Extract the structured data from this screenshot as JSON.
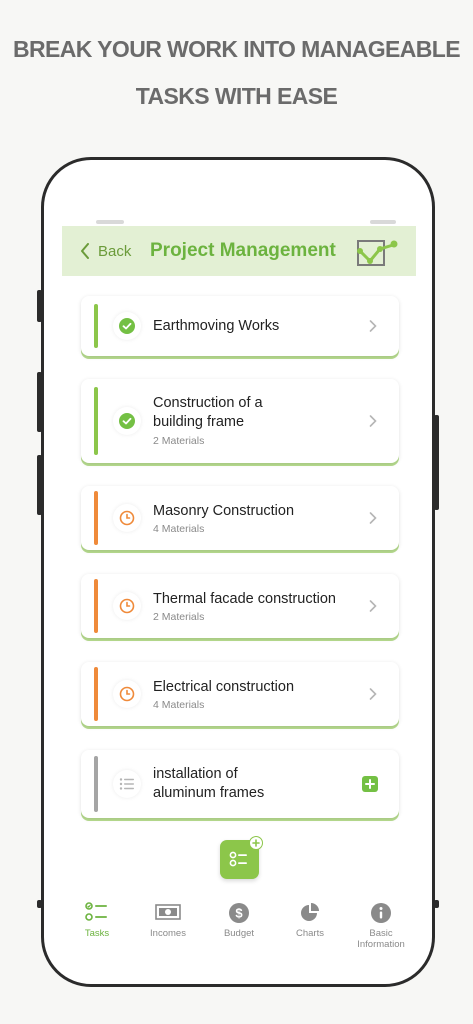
{
  "headline": {
    "line1": "BREAK YOUR WORK INTO MANAGEABLE",
    "line2": "TASKS WITH EASE"
  },
  "header": {
    "back_label": "Back",
    "title": "Project Management",
    "chart_icon": "trend-chart-icon"
  },
  "tasks": [
    {
      "name": "Earthmoving Works",
      "materials": "",
      "status": "done"
    },
    {
      "name": "Construction of a building frame",
      "name_line1": "Construction of a",
      "name_line2": "building frame",
      "materials": "2 Materials",
      "status": "done"
    },
    {
      "name": "Masonry Construction",
      "materials": "4 Materials",
      "status": "in-progress"
    },
    {
      "name": "Thermal facade construction",
      "materials": "2 Materials",
      "status": "in-progress"
    },
    {
      "name": "Electrical construction",
      "materials": "4 Materials",
      "status": "in-progress"
    },
    {
      "name": "installation of aluminum frames",
      "name_line1": "installation of",
      "name_line2": "aluminum frames",
      "materials": "",
      "status": "todo"
    }
  ],
  "tabs": [
    {
      "label": "Tasks",
      "icon": "tasks-icon",
      "active": true
    },
    {
      "label": "Incomes",
      "icon": "banknote-icon",
      "active": false
    },
    {
      "label": "Budget",
      "icon": "dollar-icon",
      "active": false
    },
    {
      "label": "Charts",
      "icon": "pie-chart-icon",
      "active": false
    },
    {
      "label": "Basic Information",
      "icon": "info-icon",
      "active": false
    }
  ],
  "colors": {
    "green": "#6cb33f",
    "orange": "#ef8a3a",
    "gray": "#9a9a9a",
    "header_bg": "#e3f0d4"
  }
}
